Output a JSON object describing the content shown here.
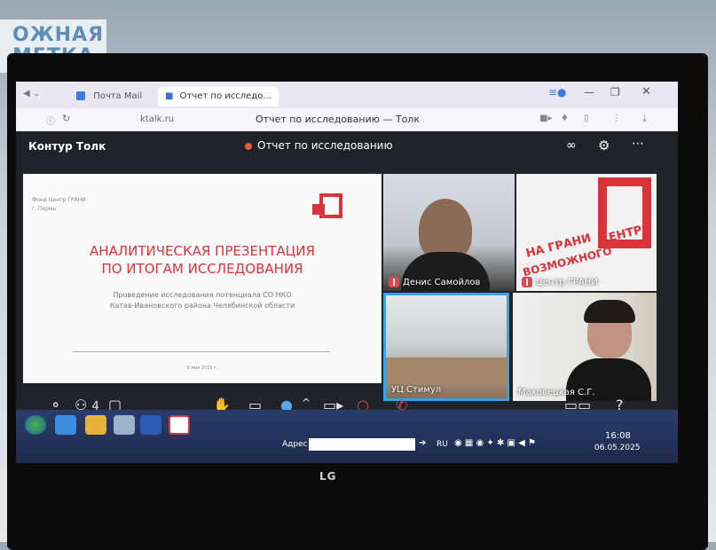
{
  "wall_sign": {
    "line1": "ОЖНАЯ",
    "line2": "МЕТКА"
  },
  "browser": {
    "tabs": [
      {
        "label": "Почта Mail",
        "active": false
      },
      {
        "label": "Отчет по исследо...",
        "active": true
      }
    ],
    "url": "ktalk.ru",
    "window_title": "Отчет по исследованию — Толк"
  },
  "app": {
    "brand": "Контур Толк",
    "meeting_title": "Отчет по исследованию",
    "participants_count": "4"
  },
  "slide": {
    "org": "Фонд Центр ГРАНИ",
    "city": "г. Пермь",
    "title_line1": "АНАЛИТИЧЕСКАЯ ПРЕЗЕНТАЦИЯ",
    "title_line2": "ПО ИТОГАМ ИССЛЕДОВАНИЯ",
    "subtitle_line1": "Проведение исследования потенциала СО НКО",
    "subtitle_line2": "Катав-Ивановского района Челябинской области",
    "date": "6 мая 2025 г."
  },
  "participants": [
    {
      "name": "Денис Самойлов",
      "muted": true
    },
    {
      "name": "Центр ГРАНИ",
      "muted": true,
      "logo_text_1": "НА ГРАНИ",
      "logo_text_2": "ВОЗМОЖНОГО",
      "logo_text_3": "ЦЕНТР"
    },
    {
      "name": "УЦ Стимул",
      "muted": false
    },
    {
      "name": "Маковецкая С.Г.",
      "muted": false
    }
  ],
  "taskbar": {
    "address_label": "Адрес",
    "lang": "RU",
    "time": "16:08",
    "date": "06.05.2025"
  },
  "monitor_brand": "LG",
  "colors": {
    "accent_red": "#d9333b",
    "active_tile_border": "#3aa3e8"
  }
}
